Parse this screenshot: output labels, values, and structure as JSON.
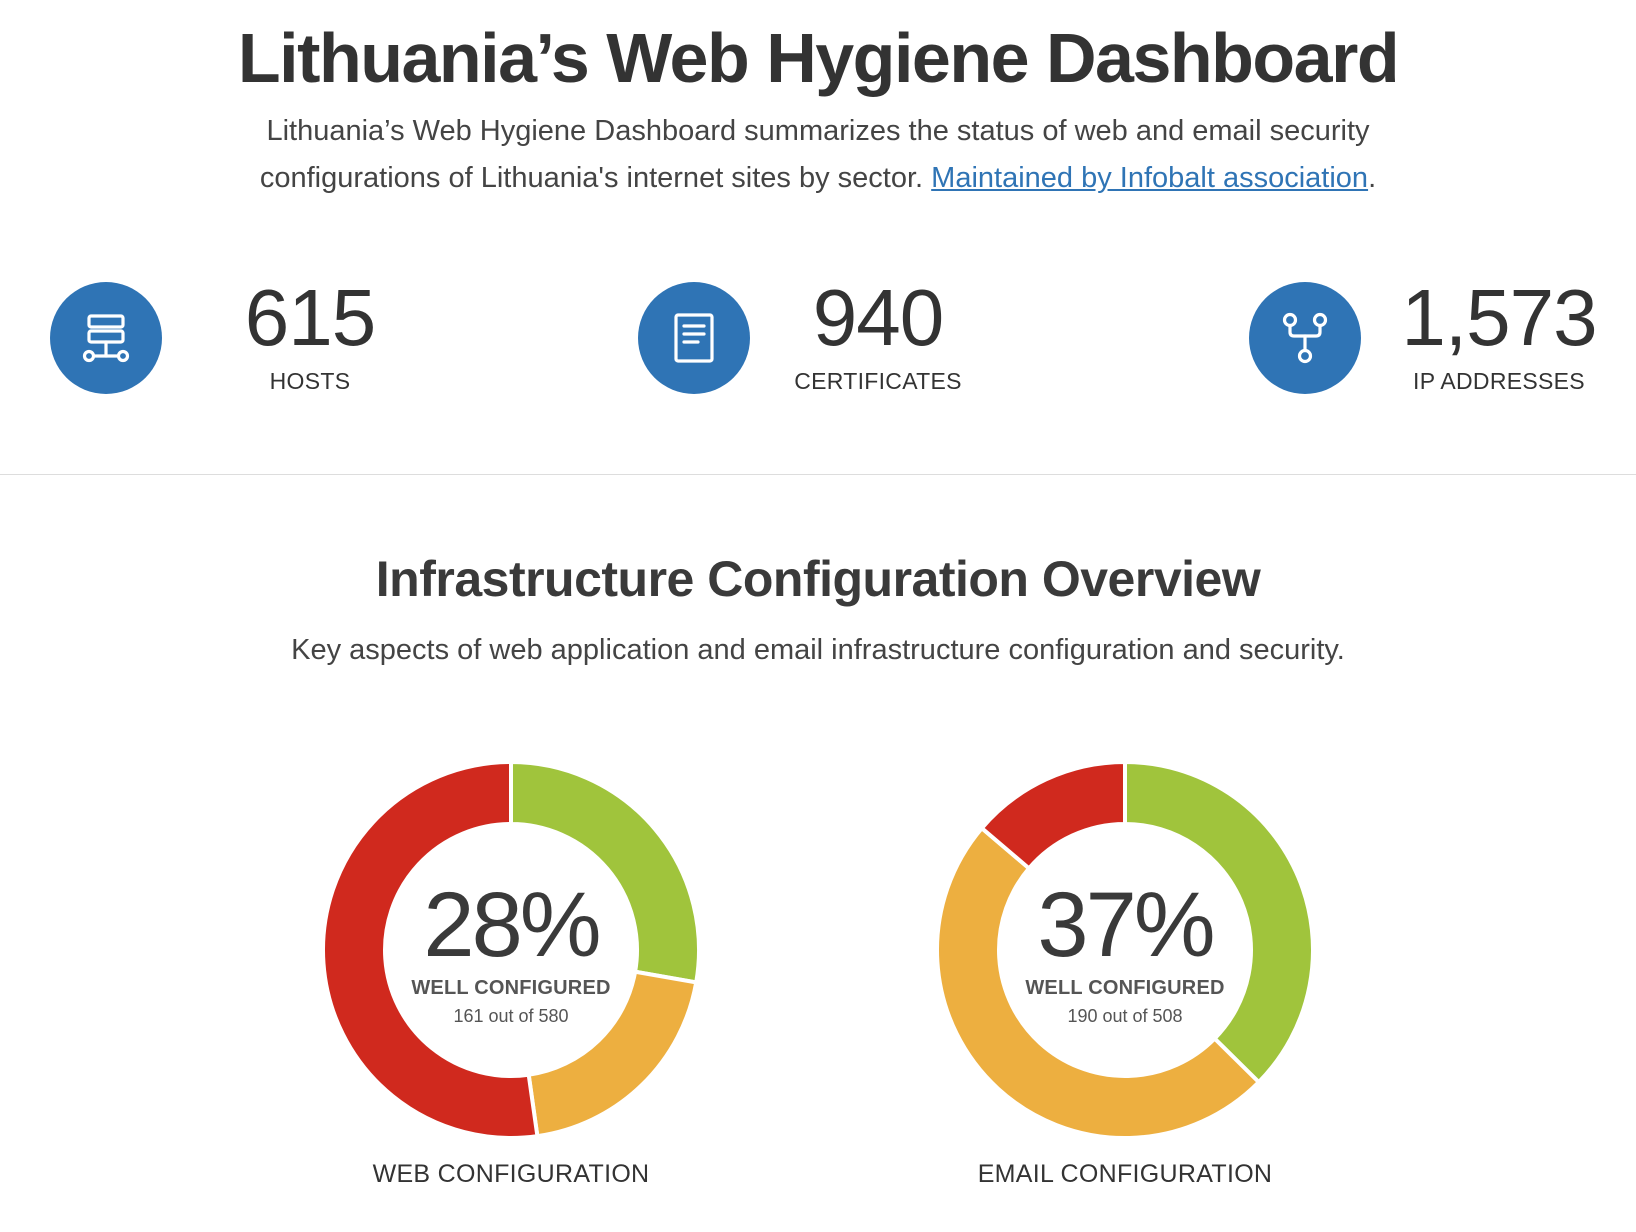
{
  "header": {
    "title": "Lithuania’s Web Hygiene Dashboard",
    "intro_text": "Lithuania’s Web Hygiene Dashboard summarizes the status of web and email security configurations of Lithuania's internet sites by sector.",
    "intro_link": "Maintained by Infobalt association",
    "intro_tail": "."
  },
  "stats": [
    {
      "value": "615",
      "label": "HOSTS",
      "icon": "server-network-icon"
    },
    {
      "value": "940",
      "label": "CERTIFICATES",
      "icon": "document-icon"
    },
    {
      "value": "1,573",
      "label": "IP ADDRESSES",
      "icon": "fork-network-icon"
    }
  ],
  "overview": {
    "title": "Infrastructure Configuration Overview",
    "subtitle": "Key aspects of web application and email infrastructure configuration and security."
  },
  "colors": {
    "accent": "#2f74b5",
    "good": "#a0c43c",
    "warning": "#edaf40",
    "bad": "#d0291e"
  },
  "chart_data": [
    {
      "type": "pie",
      "variant": "donut",
      "caption": "WEB CONFIGURATION",
      "center_percent": "28%",
      "center_label": "WELL CONFIGURED",
      "center_detail": "161 out of 580",
      "slices": [
        {
          "status": "good",
          "value": 161
        },
        {
          "status": "warning",
          "value": 116
        },
        {
          "status": "bad",
          "value": 303
        }
      ],
      "total": 580
    },
    {
      "type": "pie",
      "variant": "donut",
      "caption": "EMAIL CONFIGURATION",
      "center_percent": "37%",
      "center_label": "WELL CONFIGURED",
      "center_detail": "190 out of 508",
      "slices": [
        {
          "status": "good",
          "value": 190
        },
        {
          "status": "warning",
          "value": 248
        },
        {
          "status": "bad",
          "value": 70
        }
      ],
      "total": 508
    }
  ]
}
